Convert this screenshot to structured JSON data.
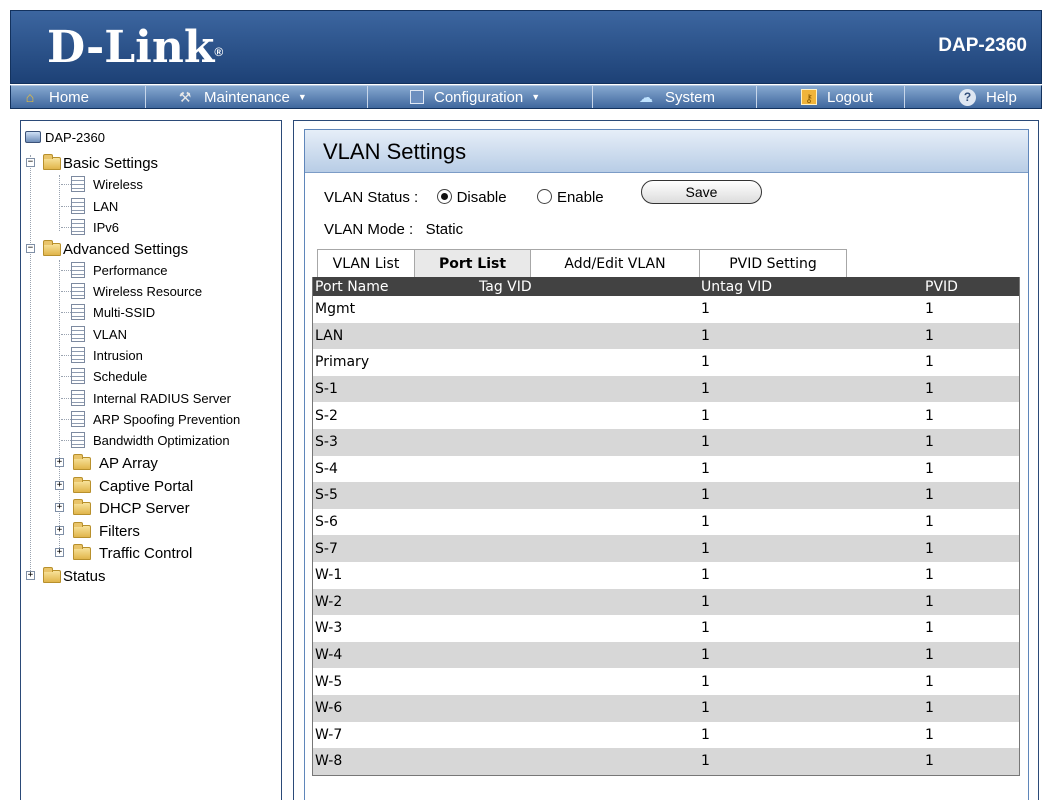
{
  "header": {
    "logo": "D-Link",
    "logo_mark": "®",
    "model": "DAP-2360"
  },
  "nav": {
    "items": [
      {
        "label": "Home",
        "icon": "home-icon",
        "dropdown": false
      },
      {
        "label": "Maintenance",
        "icon": "tools-icon",
        "dropdown": true
      },
      {
        "label": "Configuration",
        "icon": "save-disk-icon",
        "dropdown": true
      },
      {
        "label": "System",
        "icon": "system-icon",
        "dropdown": false
      },
      {
        "label": "Logout",
        "icon": "key-icon",
        "dropdown": false
      },
      {
        "label": "Help",
        "icon": "help-icon",
        "dropdown": false
      }
    ]
  },
  "sidebar": {
    "root": "DAP-2360",
    "basic_settings": "Basic Settings",
    "basic_items": [
      "Wireless",
      "LAN",
      "IPv6"
    ],
    "advanced_settings": "Advanced Settings",
    "advanced_items": [
      "Performance",
      "Wireless Resource",
      "Multi-SSID",
      "VLAN",
      "Intrusion",
      "Schedule",
      "Internal RADIUS Server",
      "ARP Spoofing Prevention",
      "Bandwidth Optimization"
    ],
    "advanced_folders": [
      "AP Array",
      "Captive Portal",
      "DHCP Server",
      "Filters",
      "Traffic Control"
    ],
    "status": "Status"
  },
  "panel": {
    "title": "VLAN Settings",
    "vlan_status_label": "VLAN Status :",
    "disable_label": "Disable",
    "enable_label": "Enable",
    "vlan_status_value": "Disable",
    "save_label": "Save",
    "vlan_mode_label": "VLAN Mode :",
    "vlan_mode_value": "Static",
    "tabs": [
      "VLAN List",
      "Port List",
      "Add/Edit VLAN",
      "PVID Setting"
    ],
    "active_tab": "Port List"
  },
  "table": {
    "headers": [
      "Port Name",
      "Tag VID",
      "Untag VID",
      "PVID"
    ],
    "rows": [
      [
        "Mgmt",
        "",
        "1",
        "1"
      ],
      [
        "LAN",
        "",
        "1",
        "1"
      ],
      [
        "Primary",
        "",
        "1",
        "1"
      ],
      [
        "S-1",
        "",
        "1",
        "1"
      ],
      [
        "S-2",
        "",
        "1",
        "1"
      ],
      [
        "S-3",
        "",
        "1",
        "1"
      ],
      [
        "S-4",
        "",
        "1",
        "1"
      ],
      [
        "S-5",
        "",
        "1",
        "1"
      ],
      [
        "S-6",
        "",
        "1",
        "1"
      ],
      [
        "S-7",
        "",
        "1",
        "1"
      ],
      [
        "W-1",
        "",
        "1",
        "1"
      ],
      [
        "W-2",
        "",
        "1",
        "1"
      ],
      [
        "W-3",
        "",
        "1",
        "1"
      ],
      [
        "W-4",
        "",
        "1",
        "1"
      ],
      [
        "W-5",
        "",
        "1",
        "1"
      ],
      [
        "W-6",
        "",
        "1",
        "1"
      ],
      [
        "W-7",
        "",
        "1",
        "1"
      ],
      [
        "W-8",
        "",
        "1",
        "1"
      ]
    ]
  }
}
